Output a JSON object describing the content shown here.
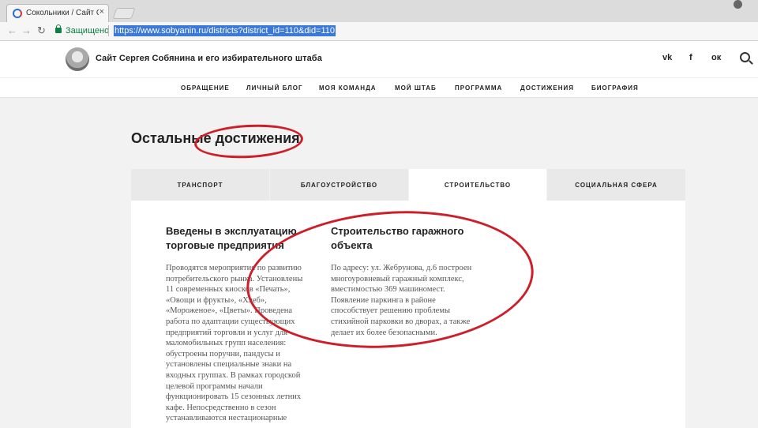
{
  "browser": {
    "tab_title": "Сокольники / Сайт Серг",
    "tab_close": "×",
    "secure_label": "Защищено",
    "url": "https://www.sobyanin.ru/districts?district_id=110&did=110",
    "icons": [
      "favicon-icon",
      "close-icon",
      "back-icon",
      "forward-icon",
      "reload-icon",
      "lock-icon",
      "profile-icon"
    ]
  },
  "site": {
    "title": "Сайт Сергея Собянина и его избирательного штаба",
    "social": {
      "vk": "vk",
      "fb": "f",
      "ok": "ок"
    },
    "nav": [
      "ОБРАЩЕНИЕ",
      "ЛИЧНЫЙ БЛОГ",
      "МОЯ КОМАНДА",
      "МОЙ ШТАБ",
      "ПРОГРАММА",
      "ДОСТИЖЕНИЯ",
      "БИОГРАФИЯ"
    ]
  },
  "content": {
    "section_title": "Остальные достижения",
    "tabs": [
      "ТРАНСПОРТ",
      "БЛАГОУСТРОЙСТВО",
      "СТРОИТЕЛЬСТВО",
      "СОЦИАЛЬНАЯ СФЕРА"
    ],
    "active_tab": "СТРОИТЕЛЬСТВО",
    "cards": [
      {
        "title_lines": [
          "Введены в эксплуатацию",
          "торговые предприятия"
        ],
        "text_lines": [
          "Проводятся мероприятия по развитию",
          "потребительского рынка. Установлены",
          "11 современных киосков «Печать»,",
          "«Овощи и фрукты», «Хлеб»,",
          "«Мороженое», «Цветы». Проведена",
          "работа по адаптации существующих",
          "предприятий торговли и услуг для",
          "маломобильных групп населения:",
          "обустроены поручни, пандусы и",
          "установлены специальные знаки на",
          "входных группах. В рамках городской",
          "целевой программы начали",
          "функционировать 15 сезонных летних",
          "кафе. Непосредственно в сезон",
          "устанавливаются нестационарные"
        ]
      },
      {
        "title_lines": [
          "Строительство гаражного",
          "объекта"
        ],
        "text_lines": [
          "По адресу: ул. Жебрунова, д.6 построен",
          "многоуровневый гаражный комплекс,",
          "вместимостью 369 машиномест.",
          "Появление паркинга в районе",
          "способствует решению проблемы",
          "стихийной парковки во дворах, а также",
          "делает их более безопасными."
        ]
      }
    ]
  },
  "colors": {
    "marker": "#cc1f2a",
    "secure": "#0b8043",
    "url_highlight": "#3b79d8"
  }
}
